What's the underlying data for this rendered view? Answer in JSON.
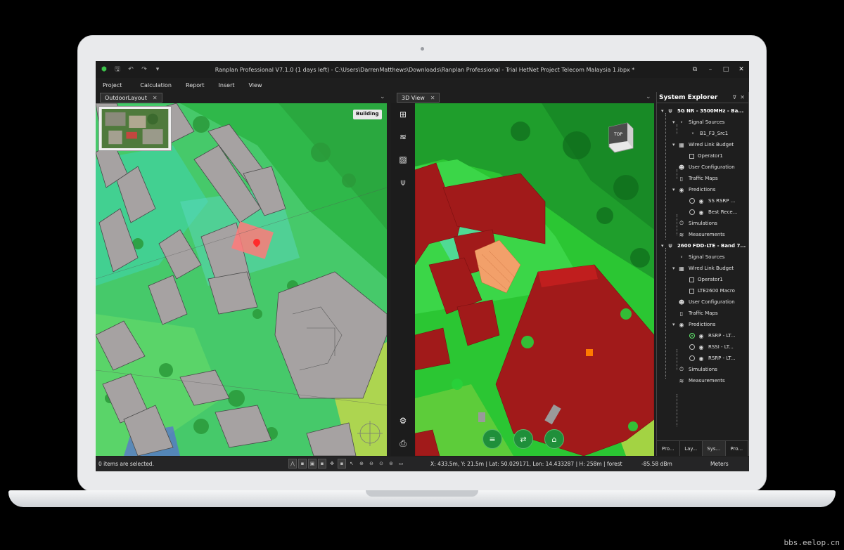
{
  "window": {
    "title": "Ranplan Professional V7.1.0 (1 days left) - C:\\Users\\DarrenMatthews\\Downloads\\Ranplan Professional - Trial HetNet Project Telecom Malaysia 1.ibpx *",
    "controls": [
      "restore",
      "minimize",
      "maximize",
      "close"
    ]
  },
  "menu": [
    "Project",
    "Calculation",
    "Report",
    "Insert",
    "View"
  ],
  "left_pane": {
    "tab_label": "OutdoorLayout",
    "building_label": "Building"
  },
  "view3d": {
    "tab_label": "3D View",
    "cube_label": "TOP"
  },
  "system_explorer": {
    "title": "System Explorer",
    "tree": [
      {
        "label": "5G NR - 3500MHz - Ba...",
        "icon": "antenna-icon"
      },
      {
        "label": "Signal Sources",
        "icon": "signal-source-icon"
      },
      {
        "label": "B1_F3_Src1",
        "icon": "signal-source-icon"
      },
      {
        "label": "Wired Link Budget",
        "icon": "link-budget-icon"
      },
      {
        "label": "Operator1",
        "icon": "checkbox"
      },
      {
        "label": "User Configuration",
        "icon": "user-icon"
      },
      {
        "label": "Traffic Maps",
        "icon": "traffic-map-icon"
      },
      {
        "label": "Predictions",
        "icon": "prediction-icon"
      },
      {
        "label": "SS RSRP ...",
        "icon": "prediction-icon"
      },
      {
        "label": "Best Rece...",
        "icon": "prediction-icon"
      },
      {
        "label": "Simulations",
        "icon": "simulation-icon"
      },
      {
        "label": "Measurements",
        "icon": "measurement-icon"
      },
      {
        "label": "2600 FDD-LTE - Band 7...",
        "icon": "antenna-icon"
      },
      {
        "label": "Signal Sources",
        "icon": "signal-source-icon"
      },
      {
        "label": "Wired Link Budget",
        "icon": "link-budget-icon"
      },
      {
        "label": "Operator1",
        "icon": "checkbox"
      },
      {
        "label": "LTE2600 Macro",
        "icon": "checkbox"
      },
      {
        "label": "User Configuration",
        "icon": "user-icon"
      },
      {
        "label": "Traffic Maps",
        "icon": "traffic-map-icon"
      },
      {
        "label": "Predictions",
        "icon": "prediction-icon"
      },
      {
        "label": "RSRP - LT...",
        "icon": "prediction-icon"
      },
      {
        "label": "RSSI - LT...",
        "icon": "prediction-icon"
      },
      {
        "label": "RSRP - LT...",
        "icon": "prediction-icon"
      },
      {
        "label": "Simulations",
        "icon": "simulation-icon"
      },
      {
        "label": "Measurements",
        "icon": "measurement-icon"
      }
    ],
    "bottom_tabs": [
      "Pro...",
      "Lay...",
      "Sys...",
      "Pro..."
    ]
  },
  "status": {
    "selection": "0 items are selected.",
    "coords": "X: 433.5m, Y: 21.5m | Lat: 50.029171, Lon: 14.433287 | H: 258m | forest",
    "signal": "-85.58 dBm",
    "units": "Meters"
  },
  "colors": {
    "coverage_green": "#3fd05b",
    "building_red": "#a11a1a",
    "app_dark": "#1e1e1e"
  },
  "watermark": "bbs.eelop.cn"
}
